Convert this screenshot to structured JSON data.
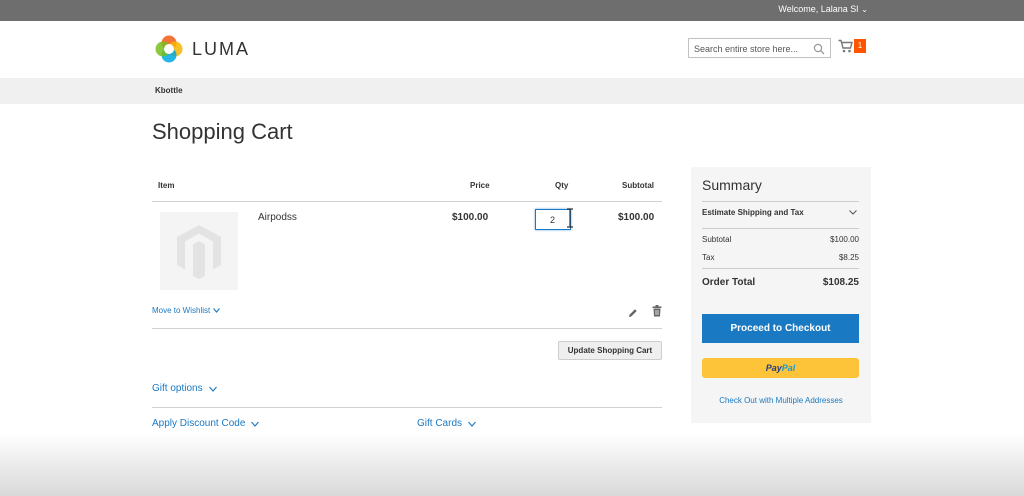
{
  "topbar": {
    "welcome": "Welcome, Lalana Sl"
  },
  "header": {
    "logo_text": "LUMA",
    "search_placeholder": "Search entire store here...",
    "cart_count": "1"
  },
  "breadcrumb": {
    "current": "Kbottle"
  },
  "page": {
    "title": "Shopping Cart"
  },
  "cart": {
    "columns": {
      "item": "Item",
      "price": "Price",
      "qty": "Qty",
      "subtotal": "Subtotal"
    },
    "items": [
      {
        "name": "Airpodss",
        "price": "$100.00",
        "qty": "2",
        "subtotal": "$100.00"
      }
    ],
    "move_to_wishlist": "Move to Wishlist",
    "update_button": "Update Shopping Cart",
    "gift_options": "Gift options",
    "apply_discount": "Apply Discount Code",
    "gift_cards": "Gift Cards"
  },
  "summary": {
    "title": "Summary",
    "estimate": "Estimate Shipping and Tax",
    "subtotal_label": "Subtotal",
    "subtotal_value": "$100.00",
    "tax_label": "Tax",
    "tax_value": "$8.25",
    "order_total_label": "Order Total",
    "order_total_value": "$108.25",
    "checkout_button": "Proceed to Checkout",
    "paypal_pay": "Pay",
    "paypal_pal": "Pal",
    "multi_address": "Check Out with Multiple Addresses"
  },
  "colors": {
    "accent_blue": "#1979c3",
    "cart_badge": "#ff5501",
    "paypal_yellow": "#fdc439",
    "topbar": "#6e6e6e"
  },
  "icons": [
    "chevron-down-icon",
    "luma-logo-icon",
    "search-icon",
    "cart-icon",
    "magento-placeholder-icon",
    "text-cursor-icon",
    "pencil-icon",
    "trash-icon"
  ]
}
